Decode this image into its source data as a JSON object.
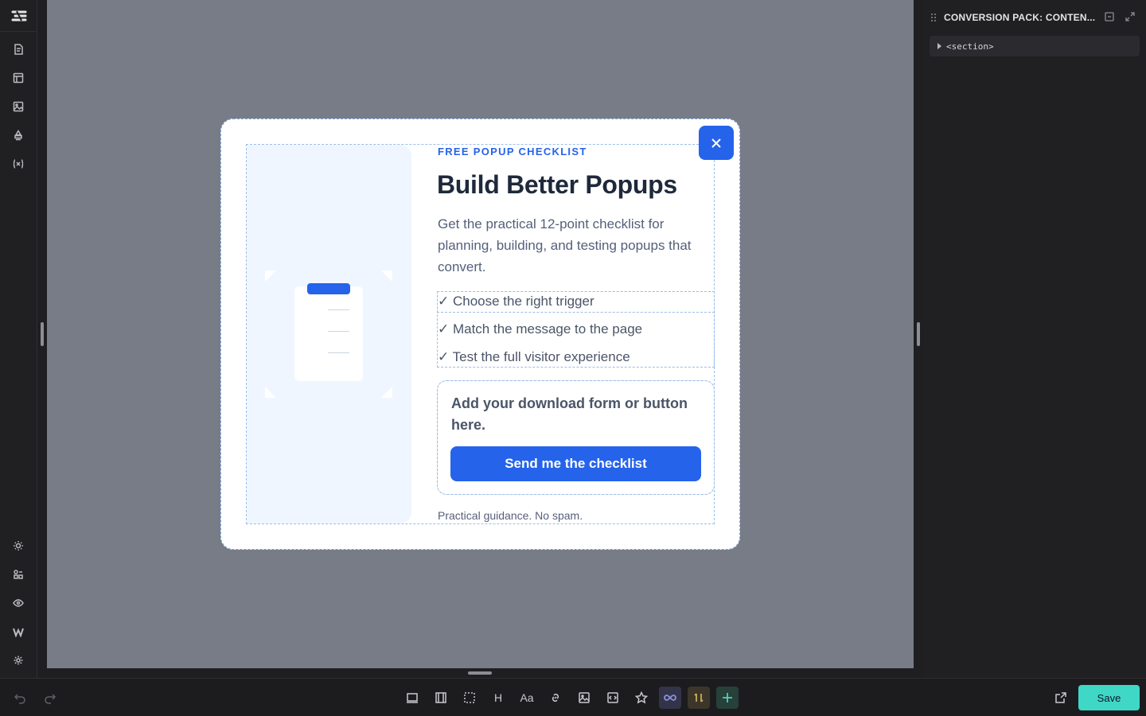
{
  "colors": {
    "accent": "#2563eb",
    "save": "#3fd8c6",
    "canvas": "#787c87",
    "panel": "#202023"
  },
  "sidebar": {
    "logo_icon": "builder-logo-icon",
    "top_items": [
      "pages-icon",
      "templates-icon",
      "media-icon",
      "style-icon",
      "variables-icon"
    ],
    "bottom_items": [
      "theme-icon",
      "components-icon",
      "preview-icon",
      "wordpress-icon",
      "settings-icon"
    ]
  },
  "popup": {
    "eyebrow": "FREE POPUP CHECKLIST",
    "title": "Build Better Popups",
    "description": "Get the practical 12-point checklist for planning, building, and testing popups that convert.",
    "checklist": [
      "✓ Choose the right trigger",
      "✓ Match the message to the page",
      "✓ Test the full visitor experience"
    ],
    "form_text": "Add your download form or button here.",
    "cta_label": "Send me the checklist",
    "footnote": "Practical guidance. No spam.",
    "close_icon": "close-icon",
    "image_icon": "clipboard-icon"
  },
  "structure_panel": {
    "title": "CONVERSION PACK: CONTEN...",
    "tree": [
      {
        "label": "<section>"
      }
    ]
  },
  "toolbar": {
    "undo_icon": "undo-icon",
    "redo_icon": "redo-icon",
    "heading_label": "H",
    "text_label": "Aa",
    "save_label": "Save"
  }
}
